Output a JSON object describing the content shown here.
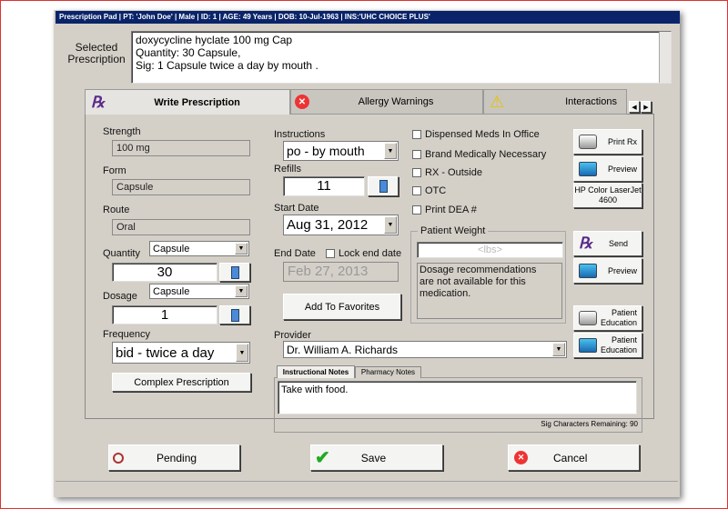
{
  "title": "Prescription Pad | PT: 'John Doe' | Male | ID: 1 | AGE: 49 Years | DOB: 10-Jul-1963 | INS:'UHC CHOICE PLUS'",
  "selected": {
    "label": "Selected Prescription",
    "lines": [
      "doxycycline hyclate 100 mg Cap",
      "Quantity: 30 Capsule,",
      "Sig:  1 Capsule twice a day  by mouth ."
    ]
  },
  "tabs": [
    {
      "label": "Write Prescription",
      "icon": "rx-icon"
    },
    {
      "label": "Allergy Warnings",
      "icon": "error-icon"
    },
    {
      "label": "Interactions",
      "icon": "warning-icon"
    }
  ],
  "form": {
    "strength_label": "Strength",
    "strength": "100 mg",
    "form_label": "Form",
    "form": "Capsule",
    "route_label": "Route",
    "route": "Oral",
    "quantity_label": "Quantity",
    "quantity_unit": "Capsule",
    "quantity": "30",
    "dosage_label": "Dosage",
    "dosage_unit": "Capsule",
    "dosage": "1",
    "frequency_label": "Frequency",
    "frequency": "bid  - twice a day",
    "complex_label": "Complex Prescription",
    "instructions_label": "Instructions",
    "instructions": "po - by mouth",
    "refills_label": "Refills",
    "refills": "11",
    "start_label": "Start Date",
    "start": "Aug 31, 2012",
    "end_label": "End Date",
    "lock_label": "Lock end date",
    "end": "Feb 27, 2013",
    "favorites_label": "Add To Favorites",
    "provider_label": "Provider",
    "provider": "Dr. William A. Richards",
    "notes_tabs": [
      "Instructional Notes",
      "Pharmacy Notes"
    ],
    "notes": "Take with food.",
    "sig_remaining": "Sig Characters Remaining: 90"
  },
  "checkboxes": [
    "Dispensed Meds In Office",
    "Brand Medically Necessary",
    "RX - Outside",
    "OTC",
    "Print DEA #"
  ],
  "weight": {
    "label": "Patient Weight",
    "placeholder": "<lbs>",
    "message": "Dosage recommendations are not available for this medication."
  },
  "side_buttons": {
    "print_rx": "Print Rx",
    "preview1": "Preview",
    "printer": "HP Color LaserJet 4600",
    "send": "Send",
    "preview2": "Preview",
    "edu1": "Patient Education",
    "edu2": "Patient Education"
  },
  "footer": {
    "pending": "Pending",
    "save": "Save",
    "cancel": "Cancel"
  }
}
